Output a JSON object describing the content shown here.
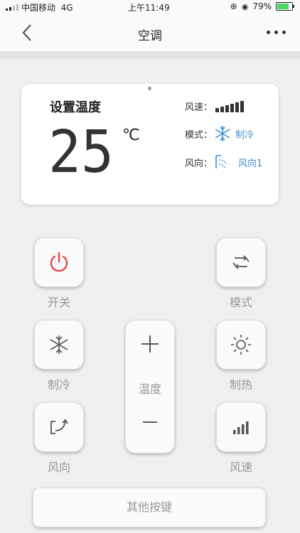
{
  "status_bar": {
    "carrier": "中国移动",
    "network": "4G",
    "time": "上午11:49",
    "battery": "79%",
    "battery_level": 0.79
  },
  "nav": {
    "title": "空调",
    "back_icon": "chevron-left-icon",
    "more_icon": "more-dots-icon"
  },
  "display": {
    "set_temp_label": "设置温度",
    "temperature": "25",
    "unit": "℃",
    "fan_speed_label": "风速：",
    "fan_speed_level": 6,
    "mode_label": "模式：",
    "mode_icon": "snowflake-icon",
    "mode_value": "制冷",
    "direction_label": "风向：",
    "direction_icon": "airflow-icon",
    "direction_value": "风向1",
    "accent_color": "#3d8fd6"
  },
  "controls": {
    "power": {
      "label": "开关",
      "icon": "power-icon",
      "icon_color": "#e04a4a"
    },
    "mode": {
      "label": "模式",
      "icon": "mode-cycle-icon"
    },
    "cool": {
      "label": "制冷",
      "icon": "snowflake-icon"
    },
    "heat": {
      "label": "制热",
      "icon": "sun-icon"
    },
    "direction": {
      "label": "风向",
      "icon": "swing-icon"
    },
    "speed": {
      "label": "风速",
      "icon": "signal-bars-icon"
    },
    "temperature": {
      "label": "温度",
      "plus": "+",
      "minus": "−"
    }
  },
  "other_keys_label": "其他按键"
}
